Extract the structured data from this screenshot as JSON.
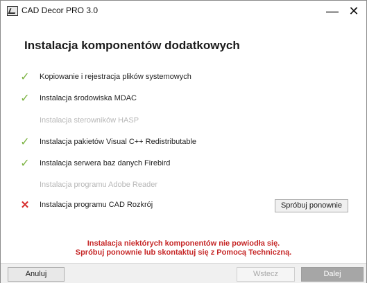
{
  "window": {
    "title": "CAD Decor PRO 3.0",
    "minimize_glyph": "—",
    "close_glyph": "✕",
    "app_icon": "cad-decor-app-icon"
  },
  "page": {
    "heading": "Instalacja komponentów dodatkowych"
  },
  "steps": [
    {
      "label": "Kopiowanie i rejestracja plików systemowych",
      "status": "done",
      "mark": "✓"
    },
    {
      "label": "Instalacja środowiska MDAC",
      "status": "done",
      "mark": "✓"
    },
    {
      "label": "Instalacja sterowników HASP",
      "status": "skipped",
      "mark": ""
    },
    {
      "label": "Instalacja pakietów Visual C++ Redistributable",
      "status": "done",
      "mark": "✓"
    },
    {
      "label": "Instalacja serwera baz danych Firebird",
      "status": "done",
      "mark": "✓"
    },
    {
      "label": "Instalacja programu Adobe Reader",
      "status": "skipped",
      "mark": ""
    },
    {
      "label": "Instalacja programu CAD Rozkrój",
      "status": "failed",
      "mark": "✕"
    }
  ],
  "retry_label": "Spróbuj ponownie",
  "message": {
    "line1": "Instalacja niektórych komponentów nie powiodła się.",
    "line2": "Spróbuj ponownie lub skontaktuj się z Pomocą Techniczną."
  },
  "buttons": {
    "cancel": "Anuluj",
    "back": "Wstecz",
    "next": "Dalej"
  },
  "colors": {
    "success": "#7cb342",
    "error": "#c62828",
    "disabled_text": "#b7b7b7"
  }
}
